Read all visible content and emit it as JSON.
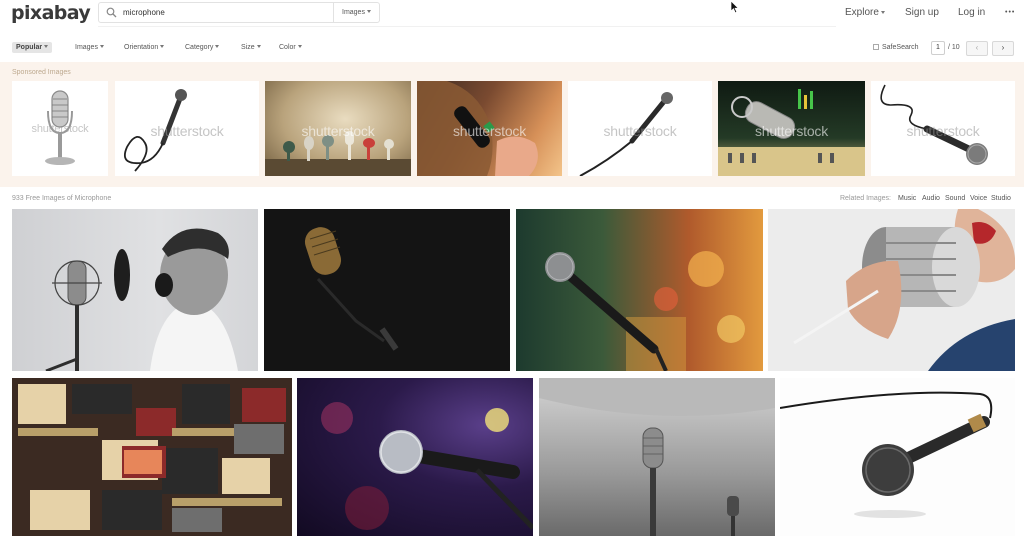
{
  "header": {
    "logo": "pixabay",
    "search_value": "microphone",
    "search_type": "Images",
    "nav": {
      "explore": "Explore",
      "signup": "Sign up",
      "login": "Log in",
      "more": "•••"
    }
  },
  "filters": {
    "popular": "Popular",
    "images": "Images",
    "orientation": "Orientation",
    "category": "Category",
    "size": "Size",
    "color": "Color",
    "safesearch": "SafeSearch",
    "page_current": "1",
    "page_total": "/ 10",
    "prev": "‹",
    "next": "›"
  },
  "sponsored": {
    "label": "Sponsored Images",
    "watermark": "shutterstock"
  },
  "results": {
    "count_label": "933 Free Images of Microphone",
    "related_label": "Related Images:",
    "related": [
      "Music",
      "Audio",
      "Sound",
      "Voice",
      "Studio"
    ]
  }
}
